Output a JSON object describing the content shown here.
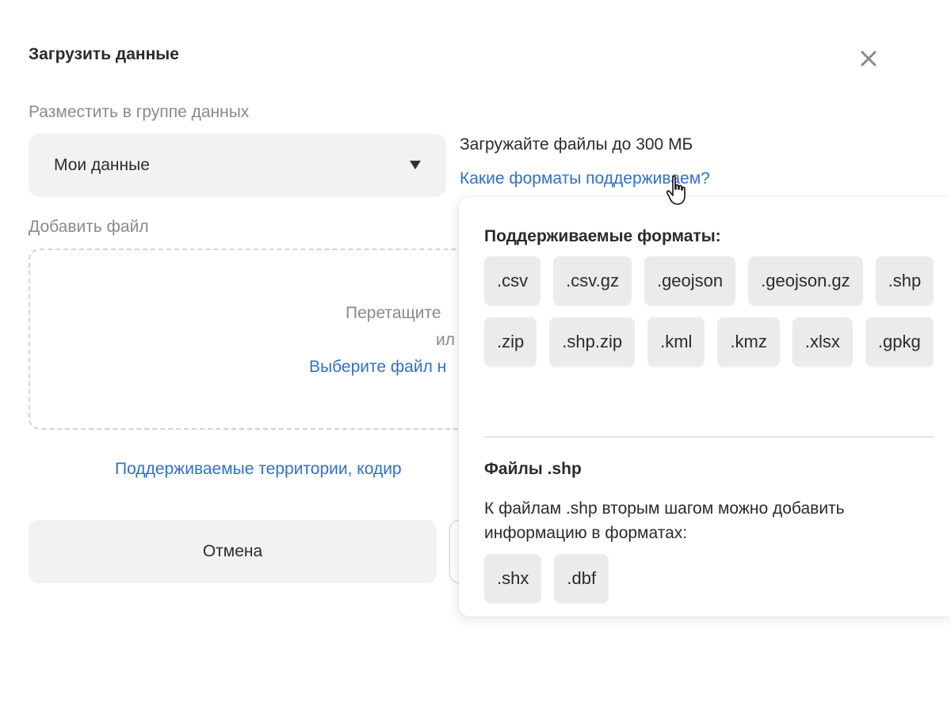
{
  "dialog": {
    "title": "Загрузить данные",
    "close_icon": "close-icon"
  },
  "group": {
    "label": "Разместить в группе данных",
    "selected": "Мои данные"
  },
  "upload_hint": {
    "text": "Загружайте файлы до 300 МБ",
    "formats_link": "Какие форматы поддерживаем?"
  },
  "file": {
    "label": "Добавить файл",
    "drop_line1": "Перетащите",
    "drop_line2": "ил",
    "choose_link": "Выберите файл н"
  },
  "territories_link": "Поддерживаемые территории, кодир",
  "buttons": {
    "cancel": "Отмена"
  },
  "popover": {
    "heading": "Поддерживаемые форматы:",
    "formats": [
      ".csv",
      ".csv.gz",
      ".geojson",
      ".geojson.gz",
      ".shp",
      ".zip",
      ".shp.zip",
      ".kml",
      ".kmz",
      ".xlsx",
      ".gpkg"
    ],
    "shp_heading": "Файлы .shp",
    "shp_text": "К файлам .shp вторым шагом можно добавить информацию в форматах:",
    "shp_formats": [
      ".shx",
      ".dbf"
    ]
  },
  "colors": {
    "link": "#2f6fd6",
    "chip_bg": "#ebebeb",
    "field_bg": "#f2f2f2"
  }
}
